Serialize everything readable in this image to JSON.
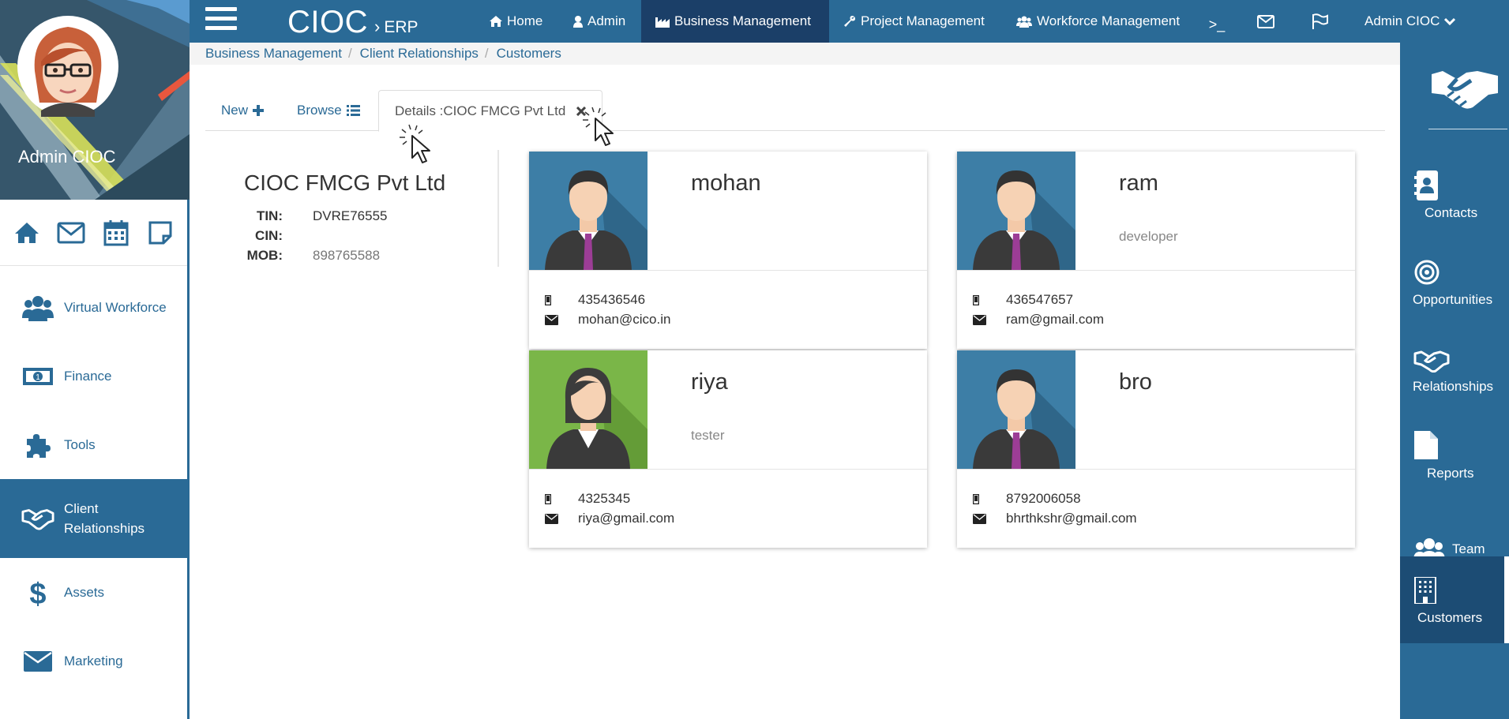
{
  "profile": {
    "name": "Admin CIOC"
  },
  "quick_icons": [
    "home-icon",
    "envelope-icon",
    "calendar-icon",
    "note-icon"
  ],
  "sidebar": {
    "items": [
      {
        "label": "Virtual Workforce",
        "icon": "users-icon",
        "active": false
      },
      {
        "label": "Finance",
        "icon": "money-icon",
        "active": false
      },
      {
        "label": "Tools",
        "icon": "puzzle-icon",
        "active": false
      },
      {
        "label": "Client Relationships",
        "icon": "handshake-icon",
        "active": true
      },
      {
        "label": "Assets",
        "icon": "dollar-icon",
        "active": false
      },
      {
        "label": "Marketing",
        "icon": "envelope-icon",
        "active": false
      }
    ]
  },
  "topbar": {
    "brand": "CIOC",
    "brand_separator": "›",
    "brand_sub": "ERP",
    "nav": [
      {
        "label": "Home",
        "icon": "home-icon"
      },
      {
        "label": "Admin",
        "icon": "user-icon"
      },
      {
        "label": "Business Management",
        "icon": "industry-icon",
        "active": true
      },
      {
        "label": "Project Management",
        "icon": "wrench-icon"
      },
      {
        "label": "Workforce Management",
        "icon": "users-icon"
      }
    ],
    "terminal_label": ">_",
    "user_menu": "Admin CIOC"
  },
  "breadcrumb": [
    "Business Management",
    "Client Relationships",
    "Customers"
  ],
  "tabs": {
    "new": "New",
    "browse": "Browse",
    "details": "Details :CIOC FMCG Pvt Ltd"
  },
  "company": {
    "name": "CIOC FMCG Pvt Ltd",
    "tin_label": "TIN:",
    "tin": "DVRE76555",
    "cin_label": "CIN:",
    "cin": "",
    "mob_label": "MOB:",
    "mob": "898765588"
  },
  "contacts": [
    {
      "name": "mohan",
      "role": "",
      "phone": "435436546",
      "email": "mohan@cico.in",
      "avatar": "male",
      "color": "#3d7ea6"
    },
    {
      "name": "ram",
      "role": "developer",
      "phone": "436547657",
      "email": "ram@gmail.com",
      "avatar": "male",
      "color": "#3d7ea6"
    },
    {
      "name": "riya",
      "role": "tester",
      "phone": "4325345",
      "email": "riya@gmail.com",
      "avatar": "female",
      "color": "#7ab648"
    },
    {
      "name": "bro",
      "role": "",
      "phone": "8792006058",
      "email": "bhrthkshr@gmail.com",
      "avatar": "male",
      "color": "#3d7ea6"
    }
  ],
  "right_sidebar": {
    "items": [
      {
        "label": "Contacts",
        "icon": "address-book-icon"
      },
      {
        "label": "Opportunities",
        "icon": "target-icon"
      },
      {
        "label": "Relationships",
        "icon": "handshake-icon"
      },
      {
        "label": "Reports",
        "icon": "file-icon"
      },
      {
        "label": "Team",
        "icon": "users-icon"
      },
      {
        "label": "Customers",
        "icon": "building-icon",
        "active": true
      }
    ]
  },
  "colors": {
    "primary": "#2a6a96",
    "primary_dark": "#1b3f68",
    "active_right": "#1c4c74"
  }
}
